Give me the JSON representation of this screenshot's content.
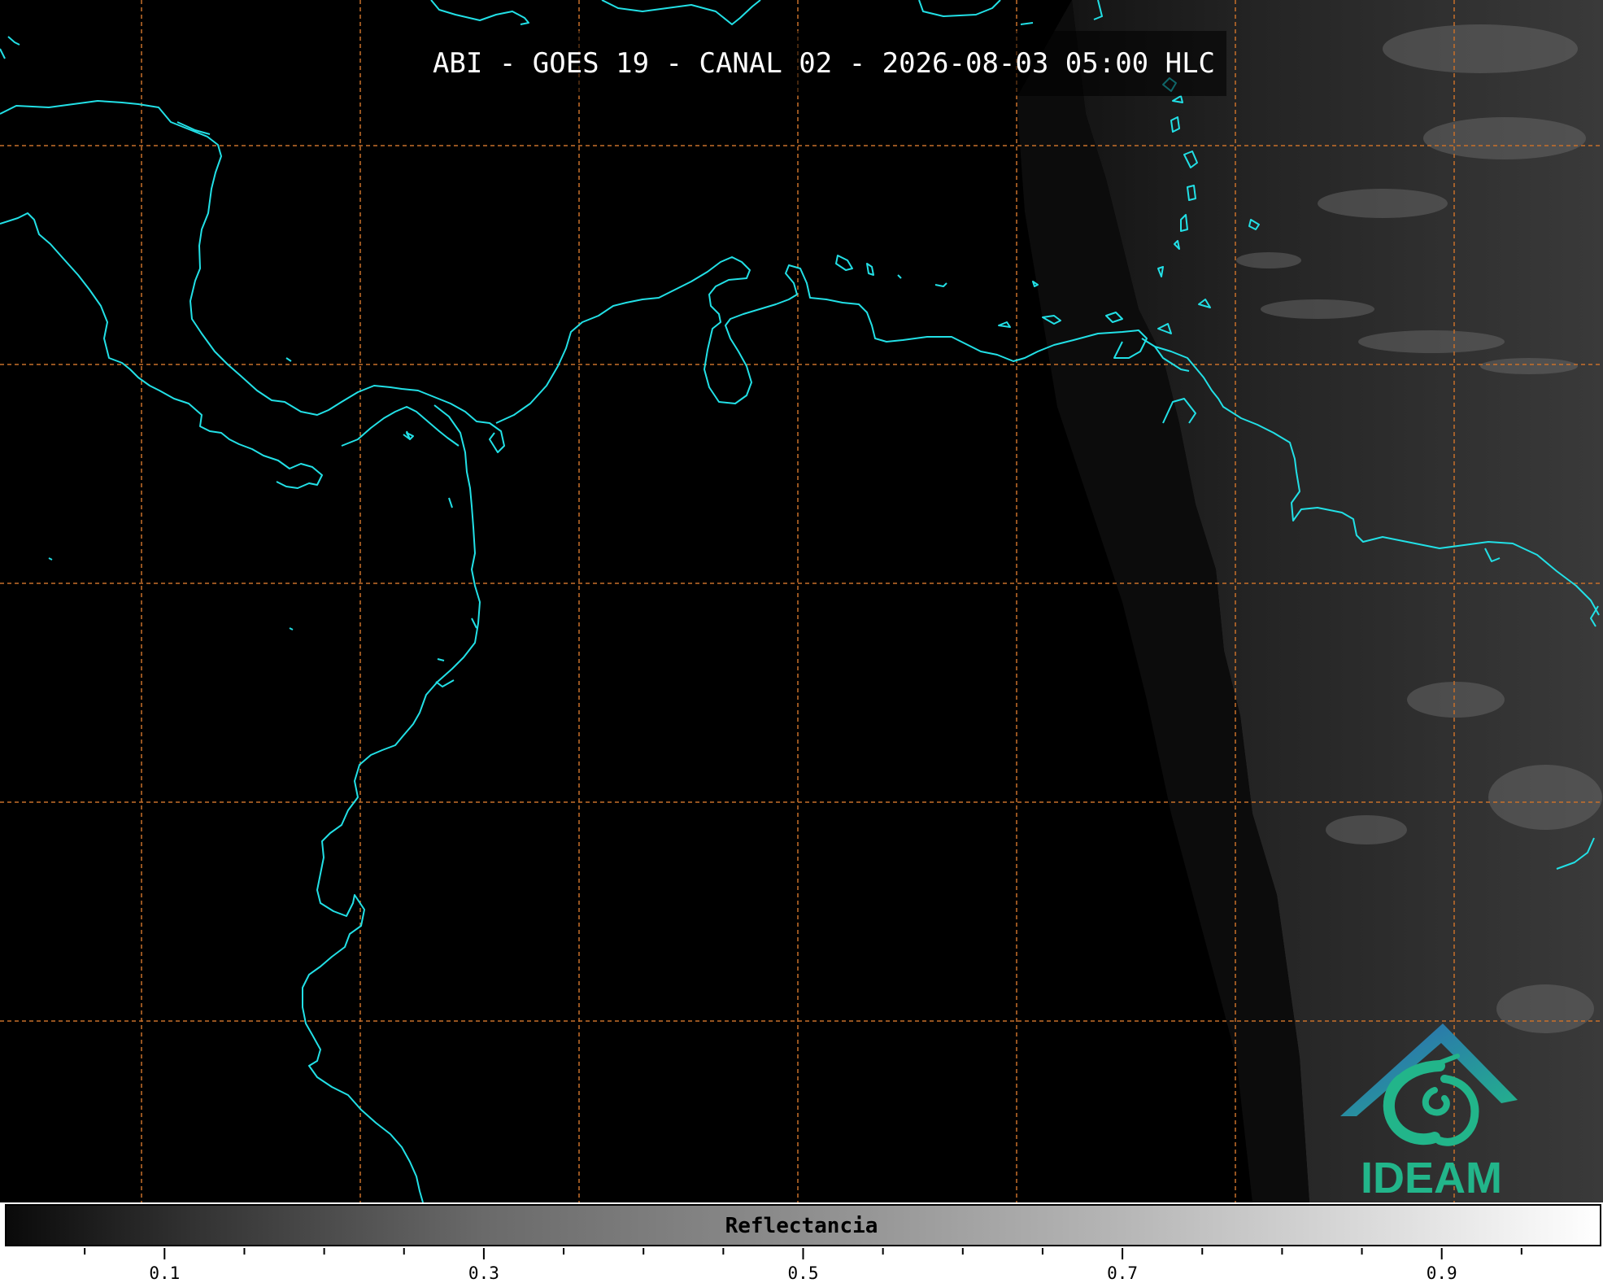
{
  "title": "ABI - GOES 19 - CANAL 02 - 2026-08-03 05:00 HLC",
  "logo": {
    "text": "IDEAM"
  },
  "colors": {
    "coastline": "#22e0e6",
    "grid": "#c8702a",
    "logo_blue": "#2e63b8",
    "logo_teal": "#22b58a"
  },
  "colorbar": {
    "label": "Reflectancia",
    "range": [
      0,
      1
    ],
    "major_ticks": [
      {
        "value": 0.1,
        "label": "0.1"
      },
      {
        "value": 0.3,
        "label": "0.3"
      },
      {
        "value": 0.5,
        "label": "0.5"
      },
      {
        "value": 0.7,
        "label": "0.7"
      },
      {
        "value": 0.9,
        "label": "0.9"
      }
    ],
    "minor_ticks": [
      0.05,
      0.15,
      0.2,
      0.25,
      0.35,
      0.4,
      0.45,
      0.55,
      0.6,
      0.65,
      0.75,
      0.8,
      0.85,
      0.95
    ]
  }
}
